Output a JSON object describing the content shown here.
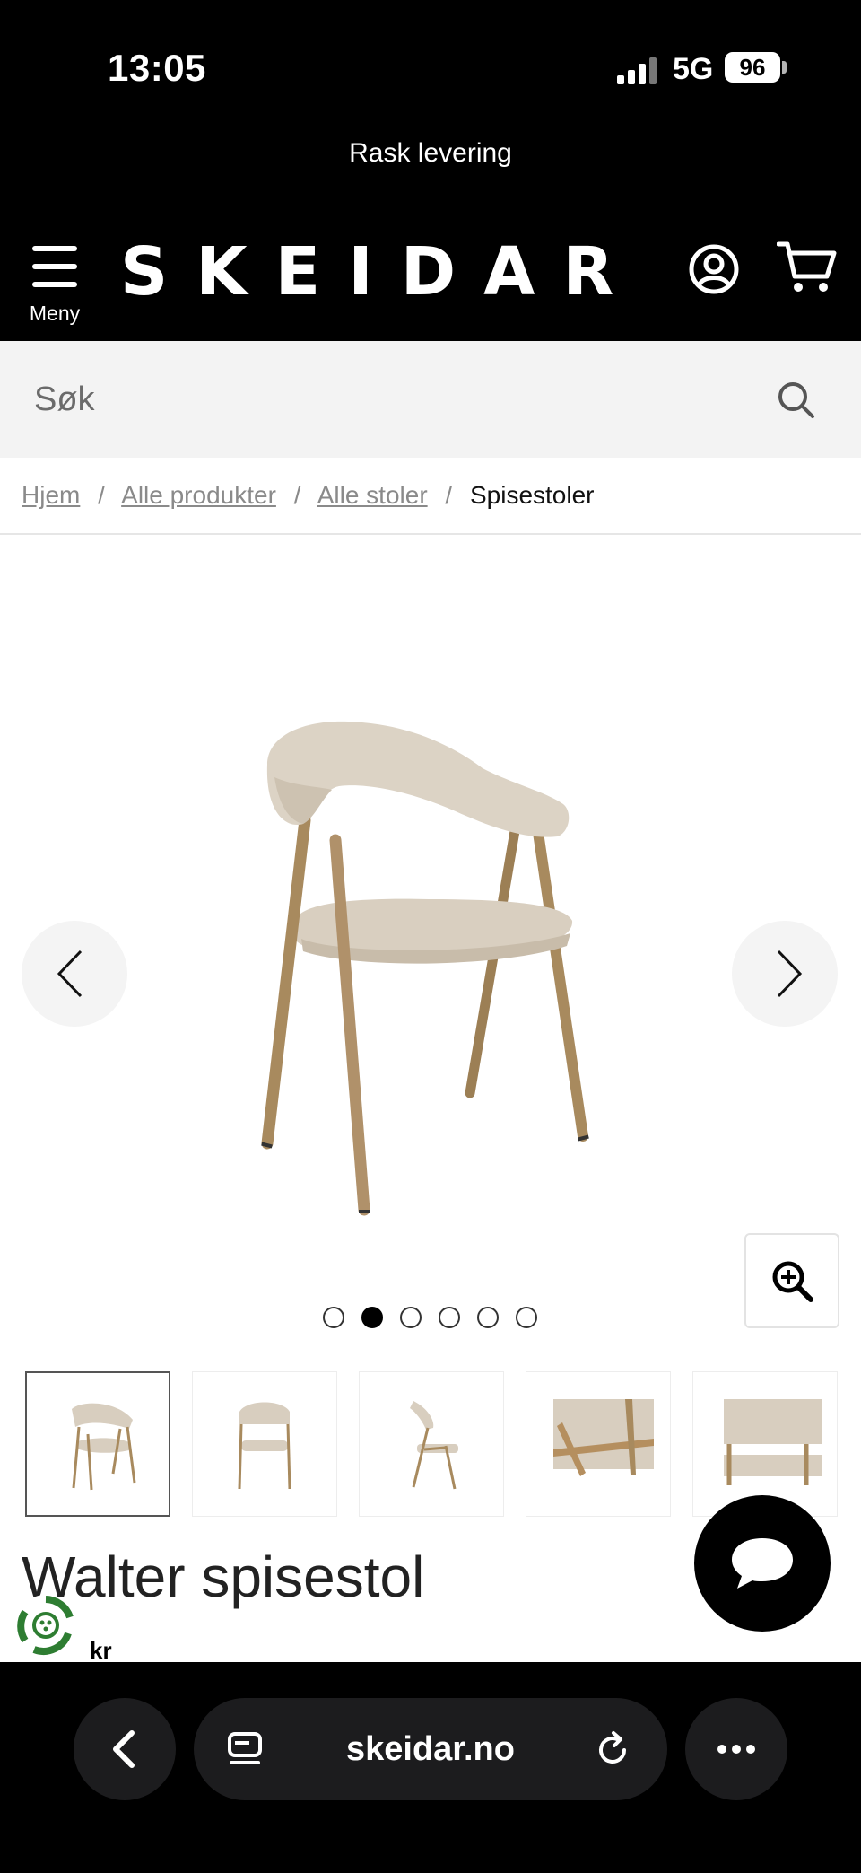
{
  "status_bar": {
    "time": "13:05",
    "network": "5G",
    "battery": "96"
  },
  "promo": {
    "text": "Rask levering"
  },
  "header": {
    "menu_label": "Meny",
    "logo": "SKEIDAR",
    "icons": [
      "menu-icon",
      "account-icon",
      "cart-icon"
    ]
  },
  "search": {
    "placeholder": "Søk"
  },
  "breadcrumb": {
    "items": [
      {
        "label": "Hjem"
      },
      {
        "label": "Alle produkter"
      },
      {
        "label": "Alle stoler"
      }
    ],
    "separator": "/",
    "current": "Spisestoler"
  },
  "gallery": {
    "image_count": 6,
    "active_index": 1,
    "thumbnail_count": 5,
    "active_thumbnail": 0
  },
  "product": {
    "title": "Walter spisestol",
    "currency": "kr"
  },
  "browser": {
    "url": "skeidar.no"
  },
  "colors": {
    "header_bg": "#000000",
    "search_bg": "#f3f3f3",
    "browser_bar_bg": "#000000",
    "accent_green": "#2e7d32"
  }
}
